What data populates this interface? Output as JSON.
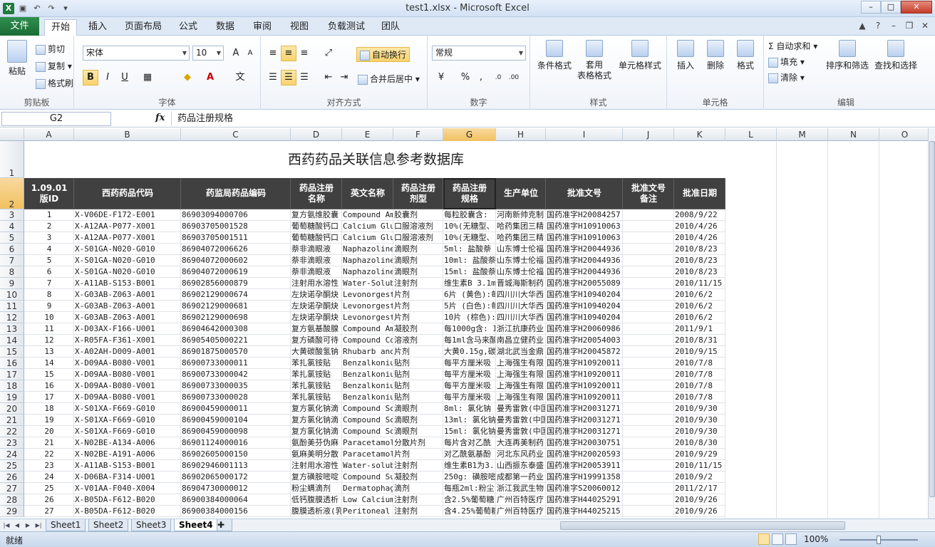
{
  "window": {
    "title": "test1.xlsx - Microsoft Excel",
    "qa_icons": [
      "excel-icon",
      "save-icon",
      "undo-icon",
      "redo-icon",
      "customize-icon"
    ],
    "controls": [
      "–",
      "□",
      "✕"
    ]
  },
  "tabs": [
    "文件",
    "开始",
    "插入",
    "页面布局",
    "公式",
    "数据",
    "审阅",
    "视图",
    "负载测试",
    "团队"
  ],
  "ribbon": {
    "clipboard": {
      "paste": "粘贴",
      "cut": "剪切",
      "copy": "复制",
      "format_painter": "格式刷",
      "label": "剪贴板"
    },
    "font": {
      "name": "宋体",
      "size": "10",
      "grow": "A",
      "shrink": "A",
      "bold": "B",
      "italic": "I",
      "underline": "U",
      "label": "字体"
    },
    "alignment": {
      "wrap": "自动换行",
      "merge": "合并后居中",
      "label": "对齐方式"
    },
    "number": {
      "format": "常规",
      "percent": "%",
      "comma": ",",
      "label": "数字"
    },
    "styles": {
      "conditional": "条件格式",
      "table": "套用\n表格格式",
      "cell_styles": "单元格样式",
      "label": "样式"
    },
    "cells": {
      "insert": "插入",
      "delete": "删除",
      "format": "格式",
      "label": "单元格"
    },
    "editing": {
      "autosum": "自动求和",
      "fill": "填充",
      "clear": "清除",
      "sort": "排序和筛选",
      "find": "查找和选择",
      "label": "编辑"
    }
  },
  "formula_bar": {
    "name_box": "G2",
    "fx": "fx",
    "content": "药品注册规格"
  },
  "columns": [
    "A",
    "B",
    "C",
    "D",
    "E",
    "F",
    "G",
    "H",
    "I",
    "J",
    "K",
    "L",
    "M",
    "N",
    "O"
  ],
  "sheet_title": "西药药品关联信息参考数据库",
  "headers": [
    "1.09.01\n版ID",
    "西药药品代码",
    "药监局药品编码",
    "药品注册\n名称",
    "英文名称",
    "药品注册\n剂型",
    "药品注册\n规格",
    "生产单位",
    "批准文号",
    "批准文号\n备注",
    "批准日期"
  ],
  "row_numbers": [
    "1",
    "2",
    "3",
    "4",
    "5",
    "6",
    "7",
    "8",
    "9",
    "10",
    "11",
    "12",
    "13",
    "14",
    "15",
    "16",
    "17",
    "18",
    "19",
    "20",
    "21",
    "22",
    "23",
    "24",
    "25",
    "26",
    "27",
    "28",
    "29"
  ],
  "rows": [
    [
      "1",
      "X-V06DE-F172-E001",
      "86903094000706",
      "复方氨维胶囊",
      "Compound Ami",
      "胶囊剂",
      "每粒胶囊含:",
      "河南新帅克制",
      "国药准字H20084257",
      "",
      "2008/9/22"
    ],
    [
      "2",
      "X-A12AA-P077-X001",
      "86903705001528",
      "葡萄糖酸钙口",
      "Calcium Glu",
      "口服溶液剂",
      "10%(无糖型、",
      "哈药集团三精",
      "国药准字H10910063",
      "",
      "2010/4/26"
    ],
    [
      "3",
      "X-A12AA-P077-X001",
      "86903705001511",
      "葡萄糖酸钙口",
      "Calcium Glu",
      "口服溶液剂",
      "10%(无糖型、",
      "哈药集团三精",
      "国药准字H10910063",
      "",
      "2010/4/26"
    ],
    [
      "4",
      "X-S01GA-N020-G010",
      "86904072006626",
      "萘非滴眼液",
      "Naphazoline",
      "滴眼剂",
      "5ml: 盐酸萘",
      "山东博士伦福",
      "国药准字H20044936",
      "",
      "2010/8/23"
    ],
    [
      "5",
      "X-S01GA-N020-G010",
      "86904072000602",
      "萘非滴眼液",
      "Naphazoline",
      "滴眼剂",
      "10ml: 盐酸萘",
      "山东博士伦福",
      "国药准字H20044936",
      "",
      "2010/8/23"
    ],
    [
      "6",
      "X-S01GA-N020-G010",
      "86904072000619",
      "萘非滴眼液",
      "Naphazoline",
      "滴眼剂",
      "15ml: 盐酸萘",
      "山东博士伦福",
      "国药准字H20044936",
      "",
      "2010/8/23"
    ],
    [
      "7",
      "X-A11AB-S153-B001",
      "86902856000879",
      "注射用水溶性",
      "Water-Solubl",
      "注射剂",
      "维生素B 3.1m",
      "晋城海斯制药",
      "国药准字H20055089",
      "",
      "2010/11/15"
    ],
    [
      "8",
      "X-G03AB-Z063-A001",
      "86902129000674",
      "左炔诺孕酮炔",
      "Levonorgestr",
      "片剂",
      "6片 (黄色):每",
      "四川川大华西",
      "国药准字H10940204",
      "",
      "2010/6/2"
    ],
    [
      "9",
      "X-G03AB-Z063-A001",
      "86902129000681",
      "左炔诺孕酮炔",
      "Levonorgestr",
      "片剂",
      "5片 (白色):每",
      "四川川大华西",
      "国药准字H10940204",
      "",
      "2010/6/2"
    ],
    [
      "10",
      "X-G03AB-Z063-A001",
      "86902129000698",
      "左炔诺孕酮炔",
      "Levonorgestr",
      "片剂",
      "10片 (棕色):",
      "四川川大华西",
      "国药准字H10940204",
      "",
      "2010/6/2"
    ],
    [
      "11",
      "X-D03AX-F166-U001",
      "86904642000308",
      "复方氨基酸腺",
      "Compound Ami",
      "凝胶剂",
      "每1000g含: I",
      "浙江抗康药业",
      "国药准字H20060986",
      "",
      "2011/9/1"
    ],
    [
      "12",
      "X-R05FA-F361-X001",
      "86905405000221",
      "复方磷酸可待",
      "Compound Cod",
      "溶液剂",
      "每1ml含马来酸",
      "南昌立健药业",
      "国药准字H20054003",
      "",
      "2010/8/31"
    ],
    [
      "13",
      "X-A02AH-D009-A001",
      "86901875000570",
      "大黄碳酸氢钠",
      "Rhubarb and",
      "片剂",
      "大黄0.15g,碳酸",
      "湖北武当金鼎",
      "国药准字H20045872",
      "",
      "2010/9/15"
    ],
    [
      "14",
      "X-D09AA-B080-V001",
      "86900733000011",
      "苯扎氯铵贴",
      "Benzalkonium",
      "贴剂",
      "每平方厘米吸",
      "上海强生有限",
      "国药准字H10920011",
      "",
      "2010/7/8"
    ],
    [
      "15",
      "X-D09AA-B080-V001",
      "86900733000042",
      "苯扎氯铵贴",
      "Benzalkonium",
      "贴剂",
      "每平方厘米吸",
      "上海强生有限",
      "国药准字H10920011",
      "",
      "2010/7/8"
    ],
    [
      "16",
      "X-D09AA-B080-V001",
      "86900733000035",
      "苯扎氯铵贴",
      "Benzalkonium",
      "贴剂",
      "每平方厘米吸",
      "上海强生有限",
      "国药准字H10920011",
      "",
      "2010/7/8"
    ],
    [
      "17",
      "X-D09AA-B080-V001",
      "86900733000028",
      "苯扎氯铵贴",
      "Benzalkonium",
      "贴剂",
      "每平方厘米吸",
      "上海强生有限",
      "国药准字H10920011",
      "",
      "2010/7/8"
    ],
    [
      "18",
      "X-S01XA-F669-G010",
      "86900459000011",
      "复方氯化钠滴",
      "Compound Sod",
      "滴眼剂",
      "8ml: 氯化钠",
      "曼秀雷敦(中国",
      "国药准字H20031271",
      "",
      "2010/9/30"
    ],
    [
      "19",
      "X-S01XA-F669-G010",
      "86900459000104",
      "复方氯化钠滴",
      "Compound Sod",
      "滴眼剂",
      "13ml: 氯化钠",
      "曼秀雷敦(中国",
      "国药准字H20031271",
      "",
      "2010/9/30"
    ],
    [
      "20",
      "X-S01XA-F669-G010",
      "86900459000098",
      "复方氯化钠滴",
      "Compound Sod",
      "滴眼剂",
      "15ml: 氯化钠",
      "曼秀雷敦(中国",
      "国药准字H20031271",
      "",
      "2010/9/30"
    ],
    [
      "21",
      "X-N02BE-A134-A006",
      "86901124000016",
      "氨酚美芬伪麻",
      "Paracetamol,",
      "分散片剂",
      "每片含对乙酰",
      "大连再美制药",
      "国药准字H20030751",
      "",
      "2010/8/30"
    ],
    [
      "22",
      "X-N02BE-A191-A006",
      "86902605000150",
      "氨麻美明分散",
      "Paracetamol",
      "片剂",
      "对乙酰氨基酚",
      "河北东风药业",
      "国药准字H20020593",
      "",
      "2010/9/29"
    ],
    [
      "23",
      "X-A11AB-S153-B001",
      "86902946001113",
      "注射用水溶性",
      "Water-solubl",
      "注射剂",
      "维生素B1为3.",
      "山西振东泰盛",
      "国药准字H20053911",
      "",
      "2010/11/15"
    ],
    [
      "24",
      "X-D06BA-F314-U001",
      "86902065000172",
      "复方磺胺嘧啶",
      "Compound Sul",
      "凝胶剂",
      "250g: 磺胺嘧啶",
      "成都第一药业",
      "国药准字H19991358",
      "",
      "2010/9/2"
    ],
    [
      "25",
      "X-V01AA-F040-X004",
      "86904730000012",
      "粉尘螨滴剂",
      "Dermatophago",
      "滴剂",
      "每瓶2ml:粉尘",
      "浙江我武生物",
      "国药准字S20060012",
      "",
      "2011/2/17"
    ],
    [
      "26",
      "X-B05DA-F612-B020",
      "86900384000064",
      "低钙腹膜透析",
      "Low Calcium",
      "注射剂",
      "含2.5%葡萄糖",
      "广州百特医疗",
      "国药准字H44025291",
      "",
      "2010/9/26"
    ],
    [
      "27",
      "X-B05DA-F612-B020",
      "86900384000156",
      "腹膜透析液(乳",
      "Peritoneal I",
      "注射剂",
      "含4.25%葡萄糖",
      "广州百特医疗",
      "国药准字H44025215",
      "",
      "2010/9/26"
    ]
  ],
  "sheets": [
    "Sheet1",
    "Sheet2",
    "Sheet3",
    "Sheet4"
  ],
  "active_sheet": "Sheet4",
  "status": {
    "ready": "就绪",
    "zoom": "100%",
    "zoom_fraction": 1.0
  }
}
